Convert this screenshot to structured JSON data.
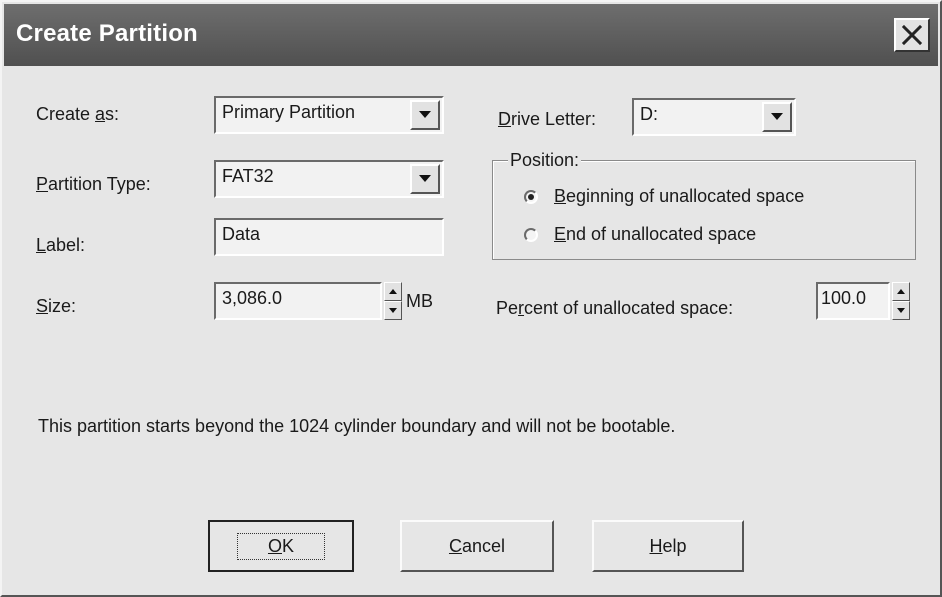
{
  "dialog": {
    "title": "Create Partition",
    "close_icon": "close-icon"
  },
  "create_as": {
    "label": "Create as:",
    "value": "Primary Partition"
  },
  "partition_type": {
    "label": "Partition Type:",
    "value": "FAT32"
  },
  "label_field": {
    "label": "Label:",
    "value": "Data"
  },
  "size": {
    "label": "Size:",
    "value": "3,086.0",
    "unit": "MB"
  },
  "drive_letter": {
    "label": "Drive Letter:",
    "value": "D:"
  },
  "position": {
    "title": "Position:",
    "options": [
      {
        "label": "Beginning of unallocated space",
        "checked": true
      },
      {
        "label": "End of unallocated space",
        "checked": false
      }
    ]
  },
  "percent": {
    "label": "Percent of unallocated space:",
    "value": "100.0"
  },
  "message": "This partition starts beyond the 1024 cylinder boundary and will not be bootable.",
  "buttons": {
    "ok": "OK",
    "cancel": "Cancel",
    "help": "Help"
  }
}
